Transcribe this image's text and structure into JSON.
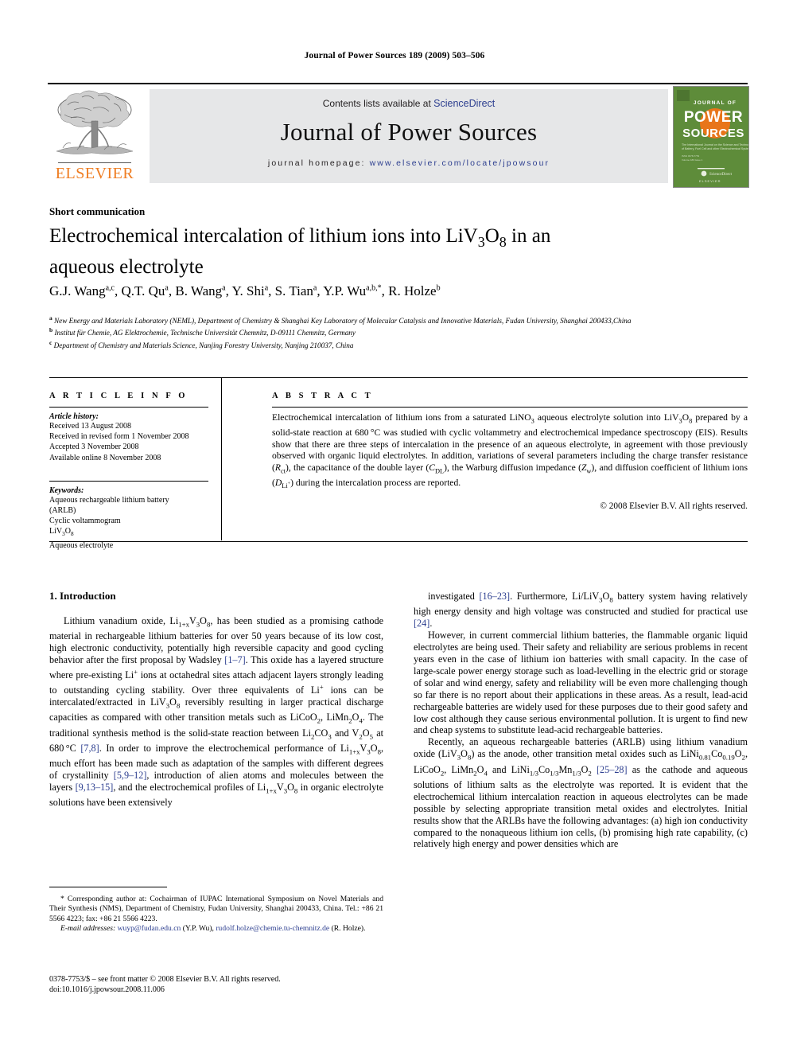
{
  "running_head": "Journal of Power Sources 189 (2009) 503–506",
  "masthead": {
    "publisher_name": "ELSEVIER",
    "contents_prefix": "Contents lists available at ",
    "contents_link": "ScienceDirect",
    "journal_title": "Journal of Power Sources",
    "homepage_prefix": "journal homepage: ",
    "homepage_url": "www.elsevier.com/locate/jpowsour",
    "cover": {
      "line1": "JOURNAL OF",
      "line2": "POWER",
      "line3": "SOURCES",
      "tagline": "The International Journal on the Science and Technology of Battery, Fuel Cell and other Electrochemical Systems",
      "footer": "ELSEVIER",
      "bg_color": "#5e8c3a",
      "accent_color": "#e8751a"
    }
  },
  "article": {
    "type_label": "Short communication",
    "title_html": "Electrochemical intercalation of lithium ions into LiV<sub>3</sub>O<sub>8</sub> in an aqueous electrolyte",
    "authors_html": "G.J. Wang<sup>a,c</sup>, Q.T. Qu<sup>a</sup>, B. Wang<sup>a</sup>, Y. Shi<sup>a</sup>, S. Tian<sup>a</sup>, Y.P. Wu<sup>a,b,*</sup>, R. Holze<sup>b</sup>",
    "affiliations_html": "<sup>a</sup> New Energy and Materials Laboratory (NEML), Department of Chemistry &amp; Shanghai Key Laboratory of Molecular Catalysis and Innovative Materials, Fudan University, Shanghai 200433,China<br><sup>b</sup> Institut für Chemie, AG Elektrochemie, Technische Universität Chemnitz, D-09111 Chemnitz, Germany<br><sup>c</sup> Department of Chemistry and Materials Science, Nanjing Forestry University, Nanjing 210037, China"
  },
  "article_info": {
    "heading": "A R T I C L E  I N F O",
    "history_label": "Article history:",
    "history": [
      "Received 13 August 2008",
      "Received in revised form 1 November 2008",
      "Accepted 3 November 2008",
      "Available online 8 November 2008"
    ],
    "keywords_label": "Keywords:",
    "keywords_html": "Aqueous rechargeable lithium battery<br>(ARLB)<br>Cyclic voltammogram<br>LiV<sub>3</sub>O<sub>8</sub><br>Aqueous electrolyte"
  },
  "abstract": {
    "heading": "A B S T R A C T",
    "body_html": "Electrochemical intercalation of lithium ions from a saturated LiNO<sub>3</sub> aqueous electrolyte solution into LiV<sub>3</sub>O<sub>8</sub> prepared by a solid-state reaction at 680&#8201;&deg;C was studied with cyclic voltammetry and electrochemical impedance spectroscopy (EIS). Results show that there are three steps of intercalation in the presence of an aqueous electrolyte, in agreement with those previously observed with organic liquid electrolytes. In addition, variations of several parameters including the charge transfer resistance (<i>R</i><sub>ct</sub>), the capacitance of the double layer (<i>C</i><sub>DL</sub>), the Warburg diffusion impedance (<i>Z</i><sub>w</sub>), and diffusion coefficient of lithium ions (<i>D</i><sub>Li<sup>+</sup></sub>) during the intercalation process are reported.",
    "copyright": "© 2008 Elsevier B.V. All rights reserved."
  },
  "introduction": {
    "heading": "1.  Introduction",
    "left_paragraphs_html": [
      "Lithium vanadium oxide, Li<sub>1+x</sub>V<sub>3</sub>O<sub>8</sub>, has been studied as a promising cathode material in rechargeable lithium batteries for over 50 years because of its low cost, high electronic conductivity, potentially high reversible capacity and good cycling behavior after the first proposal by Wadsley <span class=\"ref\">[1–7]</span>. This oxide has a layered structure where pre-existing Li<sup>+</sup> ions at octahedral sites attach adjacent layers strongly leading to outstanding cycling stability. Over three equivalents of Li<sup>+</sup> ions can be intercalated/extracted in LiV<sub>3</sub>O<sub>8</sub> reversibly resulting in larger practical discharge capacities as compared with other transition metals such as LiCoO<sub>2</sub>, LiMn<sub>2</sub>O<sub>4</sub>. The traditional synthesis method is the solid-state reaction between Li<sub>2</sub>CO<sub>3</sub> and V<sub>2</sub>O<sub>5</sub> at 680&#8201;&deg;C <span class=\"ref\">[7,8]</span>. In order to improve the electrochemical performance of Li<sub>1+x</sub>V<sub>3</sub>O<sub>8</sub>, much effort has been made such as adaptation of the samples with different degrees of crystallinity <span class=\"ref\">[5,9–12]</span>, introduction of alien atoms and molecules between the layers <span class=\"ref\">[9,13–15]</span>, and the electrochemical profiles of Li<sub>1+x</sub>V<sub>3</sub>O<sub>8</sub> in organic electrolyte solutions have been extensively"
    ],
    "right_paragraphs_html": [
      "investigated <span class=\"ref\">[16–23]</span>. Furthermore, Li/LiV<sub>3</sub>O<sub>8</sub> battery system having relatively high energy density and high voltage was constructed and studied for practical use <span class=\"ref\">[24]</span>.",
      "However, in current commercial lithium batteries, the flammable organic liquid electrolytes are being used. Their safety and reliability are serious problems in recent years even in the case of lithium ion batteries with small capacity. In the case of large-scale power energy storage such as load-levelling in the electric grid or storage of solar and wind energy, safety and reliability will be even more challenging though so far there is no report about their applications in these areas. As a result, lead-acid rechargeable batteries are widely used for these purposes due to their good safety and low cost although they cause serious environmental pollution. It is urgent to find new and cheap systems to substitute lead-acid rechargeable batteries.",
      "Recently, an aqueous rechargeable batteries (ARLB) using lithium vanadium oxide (LiV<sub>3</sub>O<sub>8</sub>) as the anode, other transition metal oxides such as LiNi<sub>0.81</sub>Co<sub>0.19</sub>O<sub>2</sub>, LiCoO<sub>2</sub>, LiMn<sub>2</sub>O<sub>4</sub> and LiNi<sub>1/3</sub>Co<sub>1/3</sub>Mn<sub>1/3</sub>O<sub>2</sub> <span class=\"ref\">[25–28]</span> as the cathode and aqueous solutions of lithium salts as the electrolyte was reported. It is evident that the electrochemical lithium intercalation reaction in aqueous electrolytes can be made possible by selecting appropriate transition metal oxides and electrolytes. Initial results show that the ARLBs have the following advantages: (a) high ion conductivity compared to the nonaqueous lithium ion cells, (b) promising high rate capability, (c) relatively high energy and power densities which are"
    ]
  },
  "footnotes": {
    "corresponding_html": "*  Corresponding author at: Cochairman of IUPAC International Symposium on Novel Materials and Their Synthesis (NMS), Department of Chemistry, Fudan University, Shanghai 200433, China. Tel.: +86 21 5566 4223; fax: +86 21 5566 4223.",
    "email_html": "<i>E-mail addresses:</i> <span class=\"email\">wuyp@fudan.edu.cn</span> (Y.P. Wu), <span class=\"email\">rudolf.holze@chemie.tu-chemnitz.de</span> (R. Holze)."
  },
  "imprint": {
    "line1_html": "0378-7753/$ – see front matter © 2008 Elsevier B.V. All rights reserved.",
    "line2_html": "doi:10.1016/j.jpowsour.2008.11.006"
  }
}
